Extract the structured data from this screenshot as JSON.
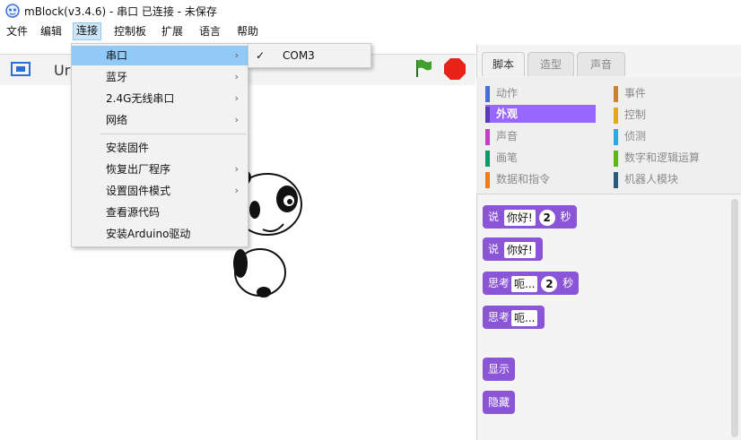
{
  "window": {
    "title": "mBlock(v3.4.6) - 串口 已连接 - 未保存"
  },
  "menubar": {
    "items": [
      {
        "label": "文件"
      },
      {
        "label": "编辑"
      },
      {
        "label": "连接"
      },
      {
        "label": "控制板"
      },
      {
        "label": "扩展"
      },
      {
        "label": "语言"
      },
      {
        "label": "帮助"
      }
    ]
  },
  "stage": {
    "sprite_name": "Ur"
  },
  "connect_menu": {
    "items": [
      {
        "label": "串口",
        "arrow": "›"
      },
      {
        "label": "蓝牙",
        "arrow": "›"
      },
      {
        "label": "2.4G无线串口",
        "arrow": "›"
      },
      {
        "label": "网络",
        "arrow": "›"
      },
      {
        "label": "安装固件"
      },
      {
        "label": "恢复出厂程序",
        "arrow": "›"
      },
      {
        "label": "设置固件模式",
        "arrow": "›"
      },
      {
        "label": "查看源代码"
      },
      {
        "label": "安装Arduino驱动"
      }
    ]
  },
  "serial_submenu": {
    "items": [
      {
        "label": "COM3",
        "checked": "✓"
      }
    ]
  },
  "palette": {
    "tabs": [
      {
        "label": "脚本"
      },
      {
        "label": "造型"
      },
      {
        "label": "声音"
      }
    ],
    "categories_left": [
      {
        "label": "动作",
        "color": "#4a6cd4"
      },
      {
        "label": "外观",
        "color": "#8a55d7"
      },
      {
        "label": "声音",
        "color": "#bb42c3"
      },
      {
        "label": "画笔",
        "color": "#0e9a6c"
      },
      {
        "label": "数据和指令",
        "color": "#ee7d16"
      }
    ],
    "categories_right": [
      {
        "label": "事件",
        "color": "#c88330"
      },
      {
        "label": "控制",
        "color": "#e1a91a"
      },
      {
        "label": "侦测",
        "color": "#2ca5e2"
      },
      {
        "label": "数字和逻辑运算",
        "color": "#5cb712"
      },
      {
        "label": "机器人模块",
        "color": "#2a5a7a"
      }
    ],
    "blocks": {
      "say_secs": {
        "verb": "说",
        "text": "你好!",
        "num": "2",
        "unit": "秒"
      },
      "say": {
        "verb": "说",
        "text": "你好!"
      },
      "think_secs": {
        "verb": "思考",
        "text": "呃...",
        "num": "2",
        "unit": "秒"
      },
      "think": {
        "verb": "思考",
        "text": "呃..."
      },
      "show": {
        "label": "显示"
      },
      "hide": {
        "label": "隐藏"
      }
    }
  }
}
